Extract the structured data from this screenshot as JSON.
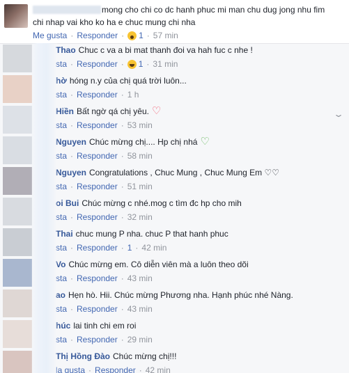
{
  "top_comment": {
    "line1": "mong cho chi co dc hanh phuc mi man chu dug jong nhu fim",
    "line2": "chi nhap vai kho ko ha e chuc mung chi nha",
    "like": "Me gusta",
    "reply": "Responder",
    "reaction_count": "1",
    "time": "57 min"
  },
  "replies": [
    {
      "author": "Thao",
      "text": "Chuc c va a bi mat thanh đoi va hah fuc c nhe !",
      "like": "sta",
      "reply": "Responder",
      "reaction": "haha",
      "reaction_count": "1",
      "time": "31 min",
      "heart": ""
    },
    {
      "author": "hờ",
      "text": "hóng n.y của chị quá trời luôn...",
      "like": "sta",
      "reply": "Responder",
      "reaction": "",
      "reaction_count": "",
      "time": "1 h",
      "heart": ""
    },
    {
      "author": "Hiền",
      "text": "Bất ngờ qá chị yêu.",
      "like": "sta",
      "reply": "Responder",
      "reaction": "",
      "reaction_count": "",
      "time": "53 min",
      "heart": "♡",
      "heart_color": "#f25268"
    },
    {
      "author": "Nguyen",
      "text": "Chúc mừng chị.... Hp chị nhá",
      "like": "sta",
      "reply": "Responder",
      "reaction": "",
      "reaction_count": "",
      "time": "58 min",
      "heart": "♡",
      "heart_color": "#5fb454"
    },
    {
      "author": "Nguyen",
      "text": "Congratulations , Chuc Mung , Chuc Mung Em ♡♡",
      "like": "sta",
      "reply": "Responder",
      "reaction": "",
      "reaction_count": "",
      "time": "51 min",
      "heart": ""
    },
    {
      "author": "oi Bui",
      "text": "Chúc mừng c nhé.mog c tìm đc hp cho mih",
      "like": "sta",
      "reply": "Responder",
      "reaction": "",
      "reaction_count": "",
      "time": "32 min",
      "heart": ""
    },
    {
      "author": "Thai",
      "text": "chuc mung P nha. chuc P that hanh phuc",
      "like": "sta",
      "reply": "Responder",
      "reaction": "",
      "reaction_count": "1",
      "time": "42 min",
      "heart": ""
    },
    {
      "author": "Vo",
      "text": "Chúc mừng em. Cô diễn viên mà a luôn theo dõi",
      "like": "sta",
      "reply": "Responder",
      "reaction": "",
      "reaction_count": "",
      "time": "43 min",
      "heart": ""
    },
    {
      "author": "ao",
      "text": "Hẹn hò. Hii. Chúc mừng Phương nha. Hạnh phúc nhé Nàng.",
      "like": "sta",
      "reply": "Responder",
      "reaction": "",
      "reaction_count": "",
      "time": "43 min",
      "heart": ""
    },
    {
      "author": "húc",
      "text": "lai tinh chi em roi",
      "like": "sta",
      "reply": "Responder",
      "reaction": "",
      "reaction_count": "",
      "time": "29 min",
      "heart": ""
    },
    {
      "author": "Thị Hồng Đào",
      "text": "Chúc mừng chị!!!",
      "like": "la gusta",
      "reply": "Responder",
      "reaction": "",
      "reaction_count": "",
      "time": "42 min",
      "heart": ""
    }
  ],
  "colors": {
    "link": "#4267b2",
    "author": "#365899",
    "meta": "#90949c",
    "bg_replies": "#f6f7f9"
  }
}
